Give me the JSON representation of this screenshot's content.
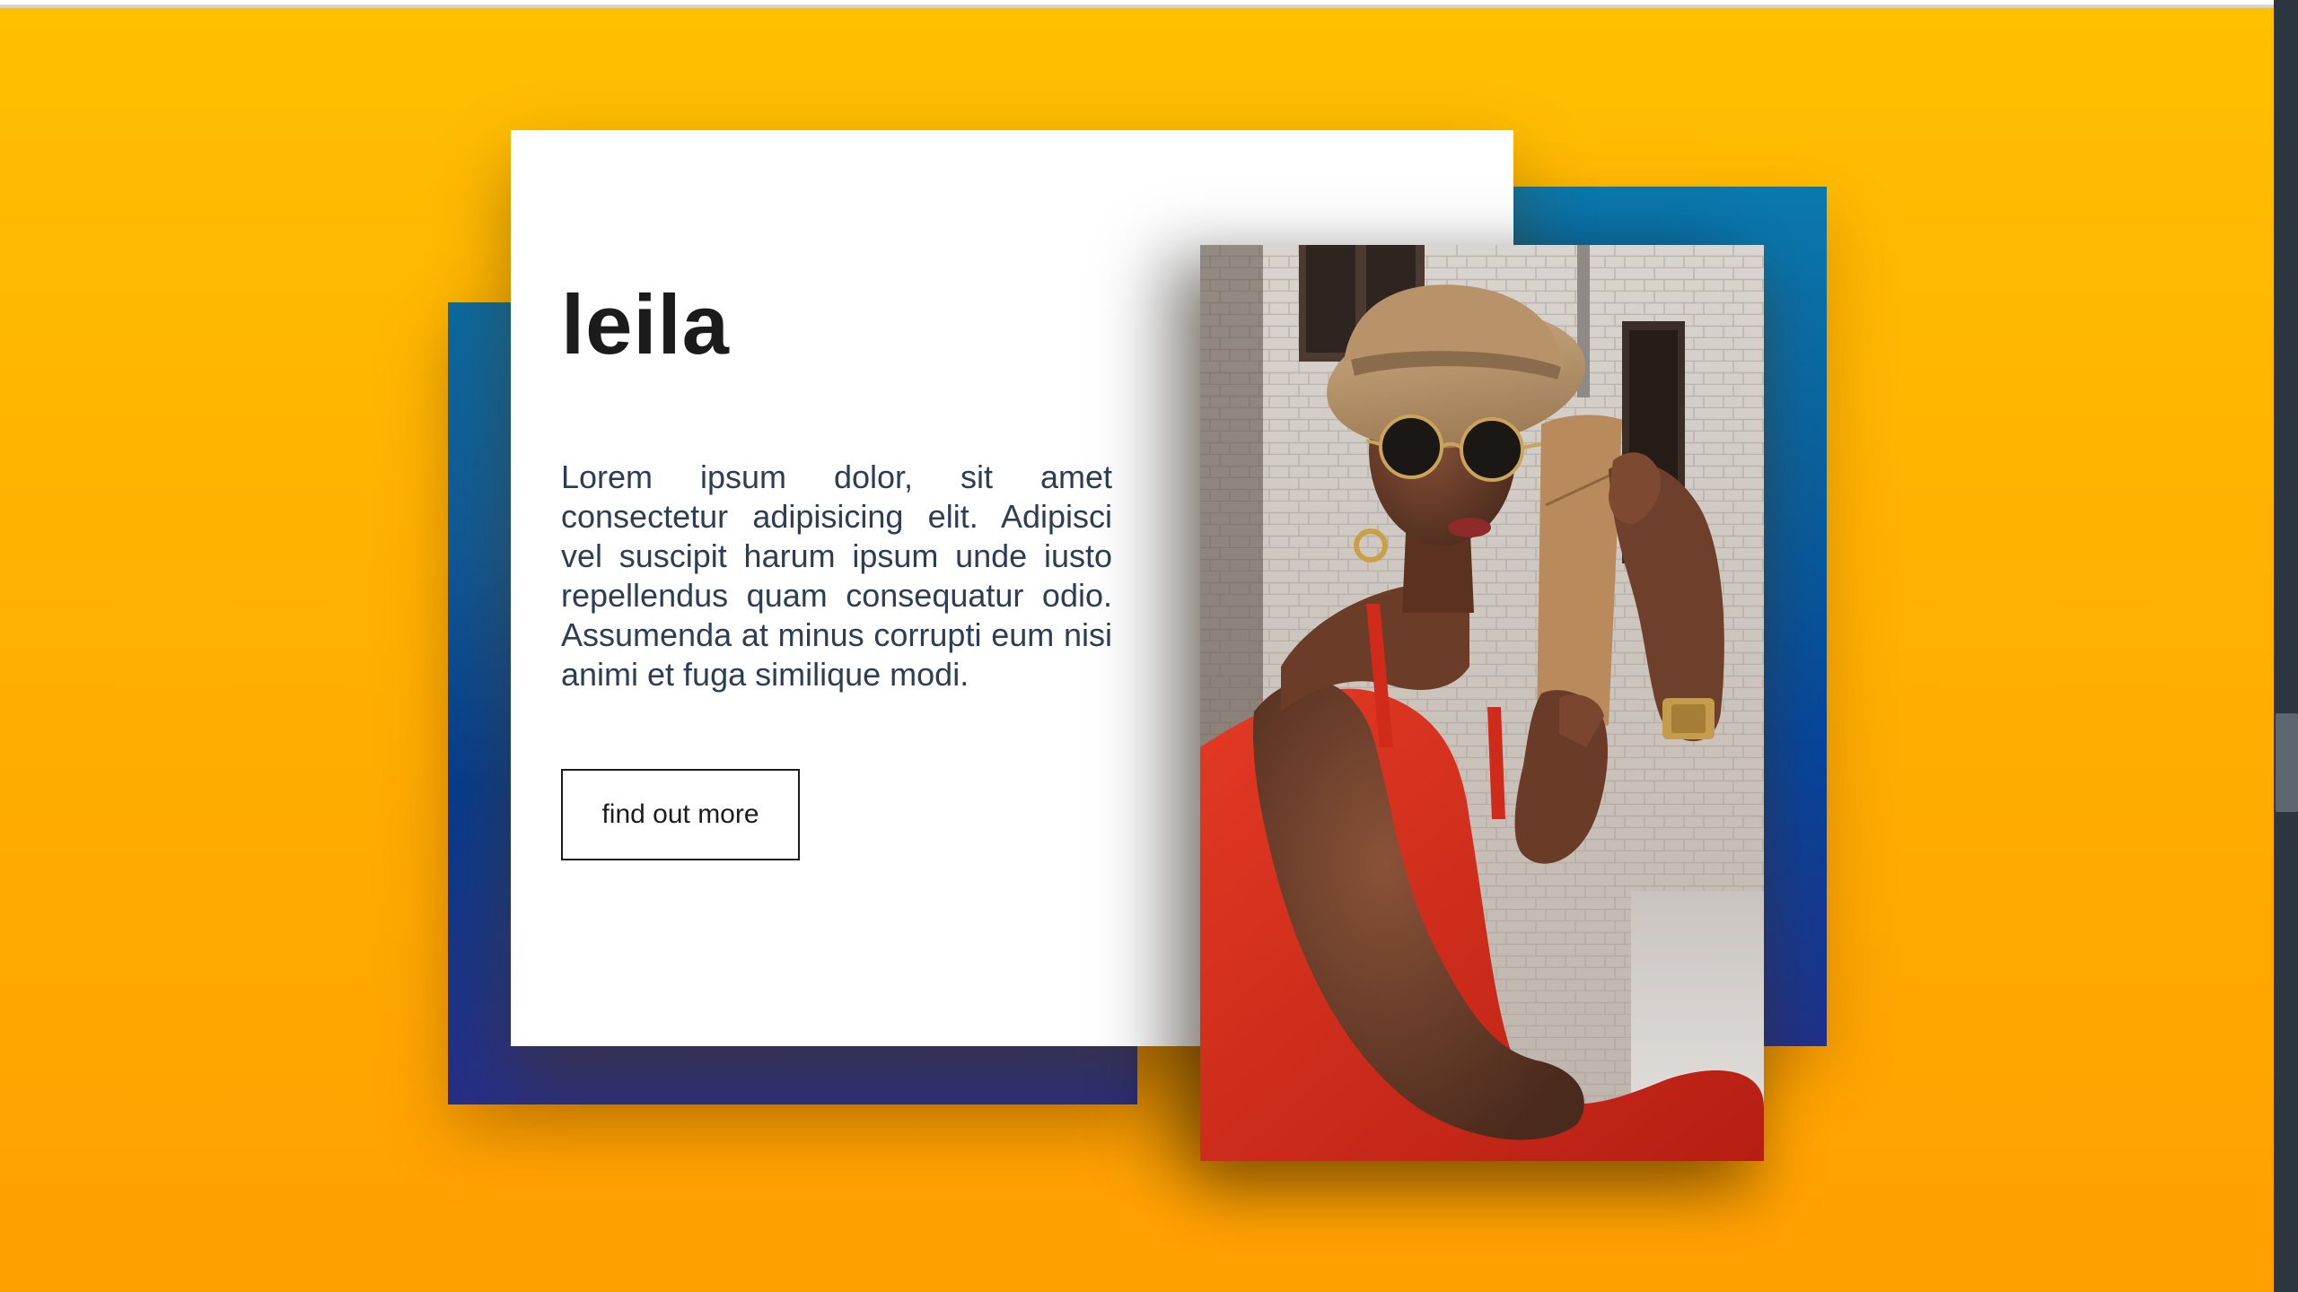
{
  "card": {
    "title": "leila",
    "body": "Lorem ipsum dolor, sit amet consectetur adipisicing elit. Adipisci vel suscipit harum ipsum unde iusto repellendus quam consequatur odio. Assumenda at minus corrupti eum nisi animi et fuga similique modi.",
    "button_label": "find out more"
  },
  "photo": {
    "icon": "portrait-photo",
    "subject": "woman in straw hat and round sunglasses holding a cork case"
  },
  "colors": {
    "background_top": "#ffc000",
    "background_bottom": "#ffa000",
    "accent_blue": "#0a6aa0",
    "accent_navy": "#262f86",
    "card": "#ffffff",
    "title": "#1b1b1b",
    "body_text": "#2c3e55",
    "scrollbar_track": "#2b3640",
    "scrollbar_thumb": "#5b6670"
  }
}
